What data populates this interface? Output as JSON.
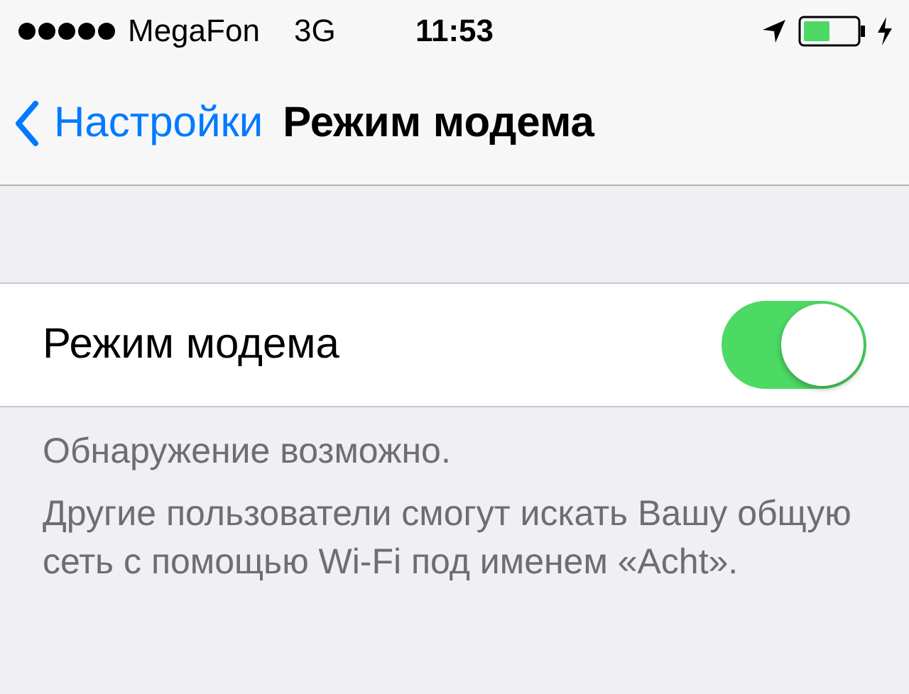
{
  "status_bar": {
    "carrier": "MegaFon",
    "network": "3G",
    "time": "11:53"
  },
  "nav": {
    "back": "Настройки",
    "title": "Режим модема"
  },
  "setting": {
    "label": "Режим модема",
    "on": true
  },
  "footer": [
    "Обнаружение возможно.",
    "Другие пользователи смогут искать Вашу общую сеть с помощью Wi-Fi под именем «Acht»."
  ]
}
